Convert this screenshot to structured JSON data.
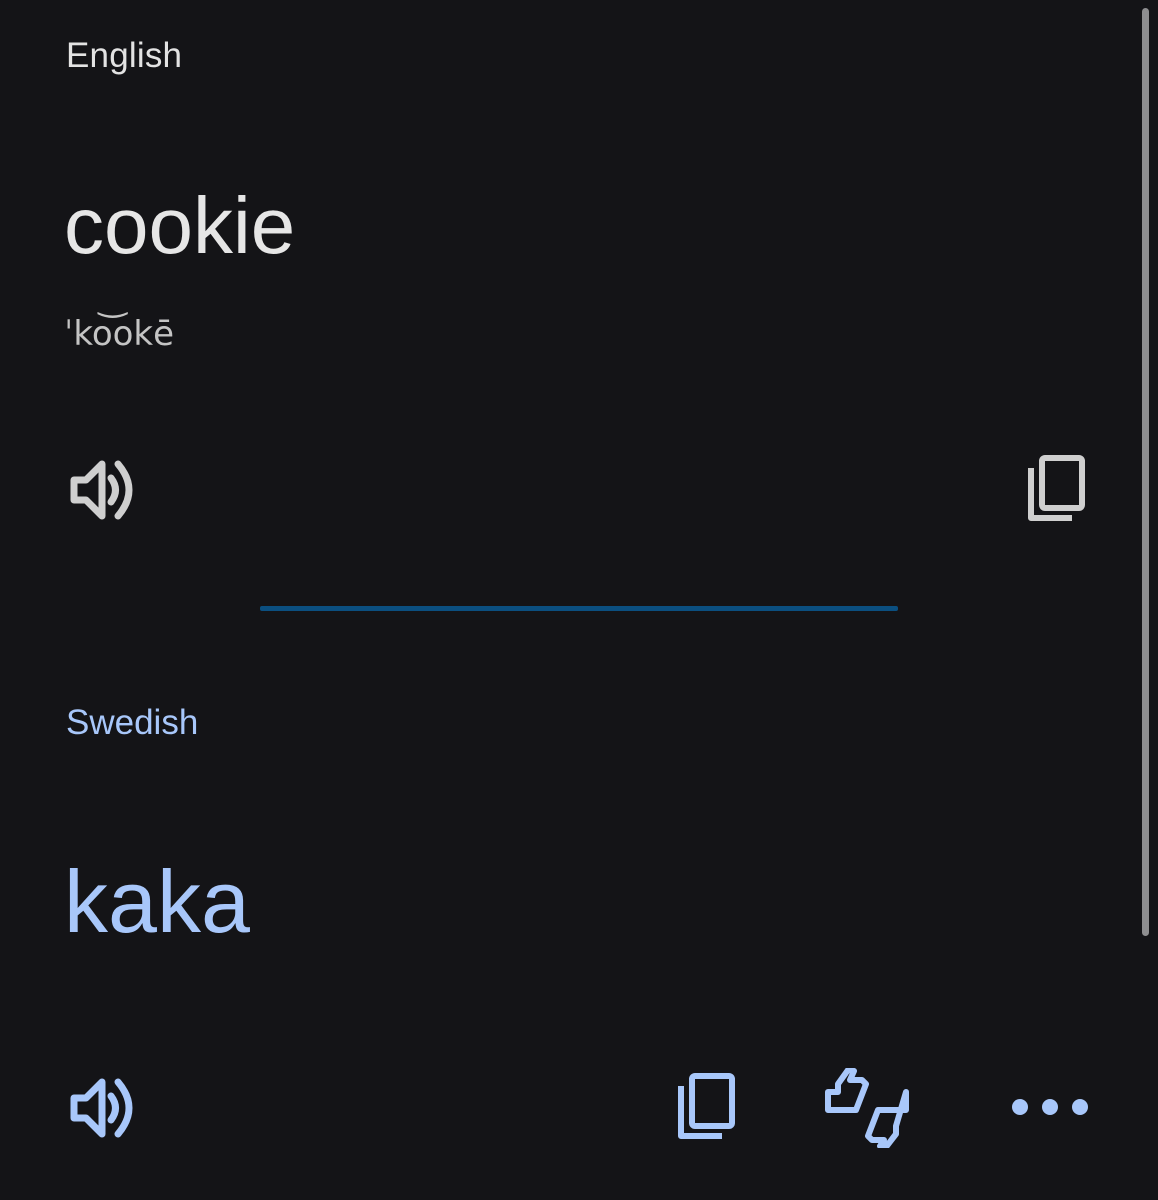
{
  "source": {
    "language": "English",
    "text": "cookie",
    "phonetic": "ˈko͝okē"
  },
  "target": {
    "language": "Swedish",
    "text": "kaka"
  },
  "icons": {
    "source_speak": "speaker-icon",
    "source_copy": "copy-icon",
    "target_speak": "speaker-icon",
    "target_copy": "copy-icon",
    "feedback": "thumbs-up-down-icon",
    "more": "more-horizontal-icon"
  },
  "colors": {
    "background": "#141417",
    "source_text": "#e3e3e3",
    "target_accent": "#a8c7fa",
    "divider": "#0b4f80"
  }
}
